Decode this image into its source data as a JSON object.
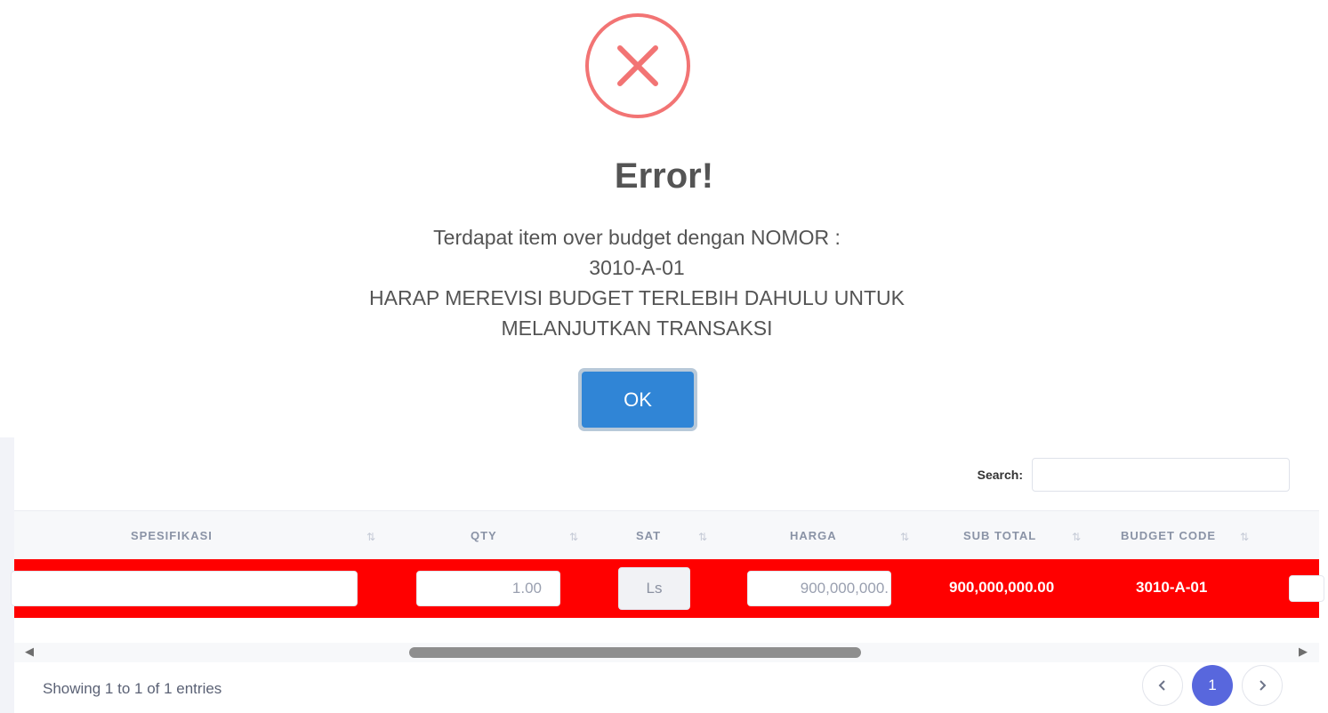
{
  "modal": {
    "title": "Error!",
    "message_lines": [
      "Terdapat item over budget dengan NOMOR :",
      "3010-A-01",
      "HARAP MEREVISI BUDGET TERLEBIH DAHULU UNTUK",
      "MELANJUTKAN TRANSAKSI"
    ],
    "ok_label": "OK",
    "icon": "error-x-icon",
    "icon_color": "#f27474",
    "button_color": "#3085d6"
  },
  "table": {
    "search_label": "Search:",
    "search_value": "",
    "columns": [
      "SPESIFIKASI",
      "QTY",
      "SAT",
      "HARGA",
      "SUB TOTAL",
      "BUDGET CODE"
    ],
    "row": {
      "spesifikasi": "",
      "qty": "1.00",
      "sat": "Ls",
      "harga": "900,000,000.",
      "sub_total": "900,000,000.00",
      "budget_code": "3010-A-01"
    },
    "row_color": "#ff0000",
    "footer_info": "Showing 1 to 1 of 1 entries",
    "pagination": {
      "prev_icon": "chevron-left-icon",
      "current_page": "1",
      "next_icon": "chevron-right-icon",
      "active_color": "#5867dd"
    }
  }
}
